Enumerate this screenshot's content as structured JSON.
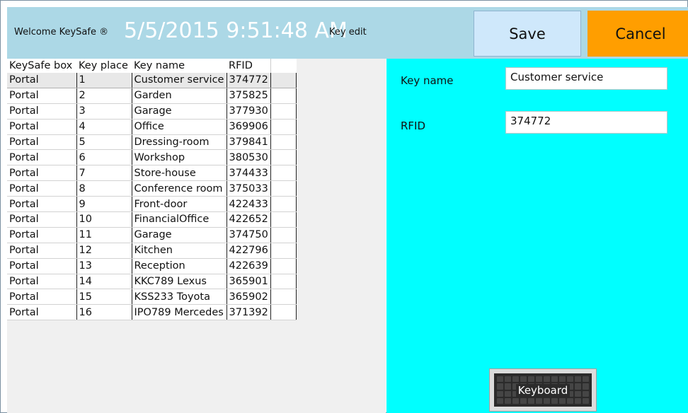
{
  "header": {
    "welcome": "Welcome KeySafe ®",
    "datetime": "5/5/2015 9:51:48 AM",
    "subtitle": "Key edit",
    "save_label": "Save",
    "cancel_label": "Cancel"
  },
  "table": {
    "columns": [
      "KeySafe box",
      "Key place",
      "Key name",
      "RFID"
    ],
    "rows": [
      [
        "Portal",
        "1",
        "Customer service",
        "374772"
      ],
      [
        "Portal",
        "2",
        "Garden",
        "375825"
      ],
      [
        "Portal",
        "3",
        "Garage",
        "377930"
      ],
      [
        "Portal",
        "4",
        "Office",
        "369906"
      ],
      [
        "Portal",
        "5",
        "Dressing-room",
        "379841"
      ],
      [
        "Portal",
        "6",
        "Workshop",
        "380530"
      ],
      [
        "Portal",
        "7",
        "Store-house",
        "374433"
      ],
      [
        "Portal",
        "8",
        "Conference room",
        "375033"
      ],
      [
        "Portal",
        "9",
        "Front-door",
        "422433"
      ],
      [
        "Portal",
        "10",
        "FinancialOffice",
        "422652"
      ],
      [
        "Portal",
        "11",
        "Garage",
        "374750"
      ],
      [
        "Portal",
        "12",
        "Kitchen",
        "422796"
      ],
      [
        "Portal",
        "13",
        "Reception",
        "422639"
      ],
      [
        "Portal",
        "14",
        "KKC789 Lexus",
        "365901"
      ],
      [
        "Portal",
        "15",
        "KSS233 Toyota",
        "365902"
      ],
      [
        "Portal",
        "16",
        "IPO789 Mercedes",
        "371392"
      ]
    ]
  },
  "form": {
    "key_name_label": "Key name",
    "key_name_value": "Customer service",
    "rfid_label": "RFID",
    "rfid_value": "374772",
    "keyboard_label": "Keyboard"
  },
  "colors": {
    "header_bg": "#acd8e6",
    "save_bg": "#cfe8fb",
    "cancel_bg": "#ff9e00",
    "form_bg": "#00ffff"
  },
  "icons": {
    "keyboard": "keyboard-icon"
  }
}
